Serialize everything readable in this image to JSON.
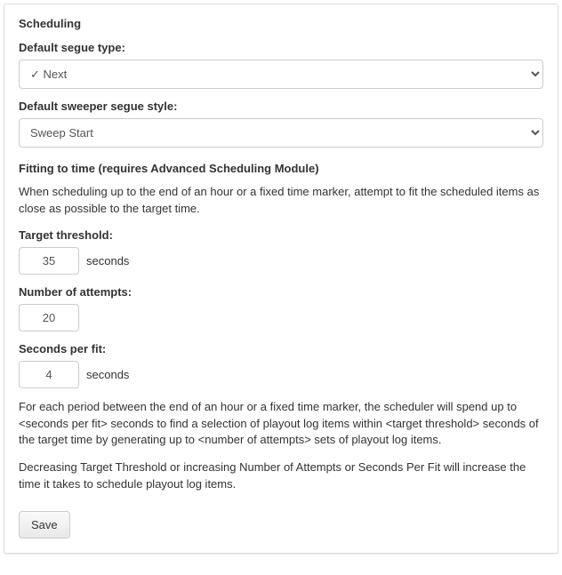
{
  "section_title": "Scheduling",
  "segue_type": {
    "label": "Default segue type:",
    "value": "✓ Next"
  },
  "sweeper_style": {
    "label": "Default sweeper segue style:",
    "value": "Sweep Start"
  },
  "fitting": {
    "heading": "Fitting to time (requires Advanced Scheduling Module)",
    "intro": "When scheduling up to the end of an hour or a fixed time marker, attempt to fit the scheduled items as close as possible to the target time.",
    "target_threshold": {
      "label": "Target threshold:",
      "value": "35",
      "unit": "seconds"
    },
    "num_attempts": {
      "label": "Number of attempts:",
      "value": "20"
    },
    "seconds_per_fit": {
      "label": "Seconds per fit:",
      "value": "4",
      "unit": "seconds"
    },
    "explain1": "For each period between the end of an hour or a fixed time marker, the scheduler will spend up to <seconds per fit> seconds to find a selection of playout log items within <target threshold> seconds of the target time by generating up to <number of attempts> sets of playout log items.",
    "explain2": "Decreasing Target Threshold or increasing Number of Attempts or Seconds Per Fit will increase the time it takes to schedule playout log items."
  },
  "save_label": "Save"
}
